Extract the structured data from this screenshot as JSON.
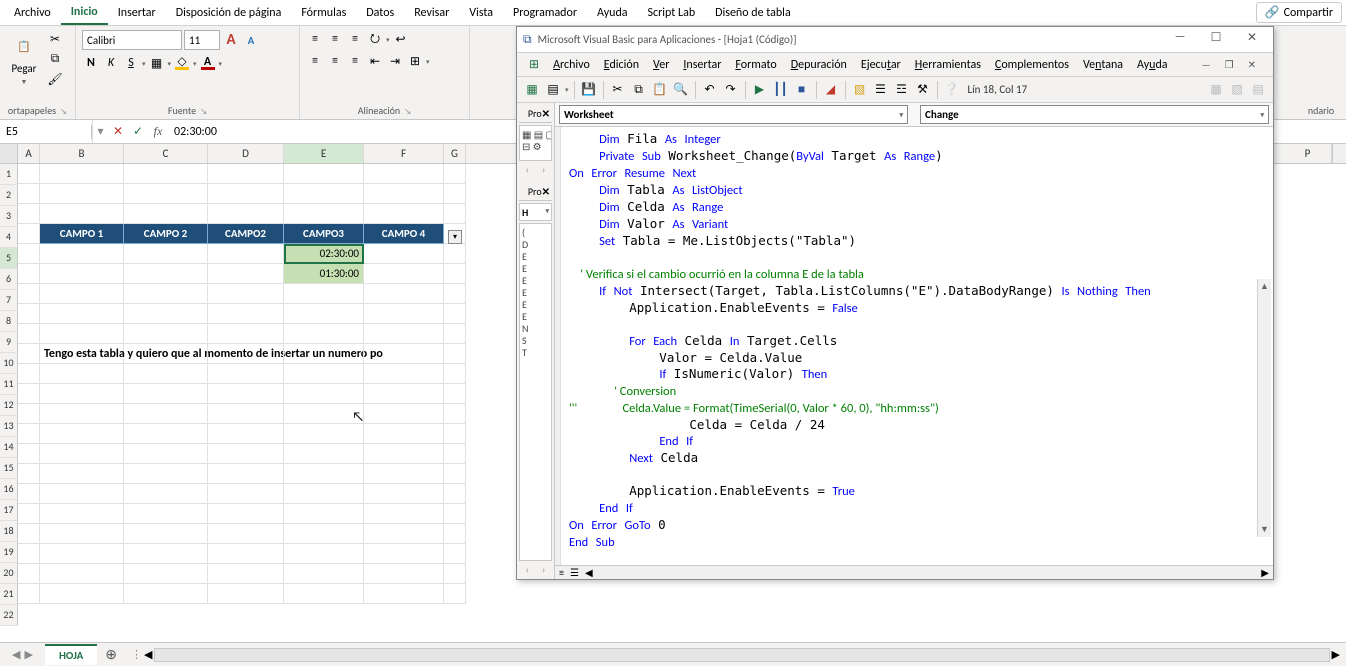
{
  "ribbon": {
    "tabs": [
      "Archivo",
      "Inicio",
      "Insertar",
      "Disposición de página",
      "Fórmulas",
      "Datos",
      "Revisar",
      "Vista",
      "Programador",
      "Ayuda",
      "Script Lab",
      "Diseño de tabla"
    ],
    "active_tab": "Inicio",
    "share": "Compartir",
    "paste_label": "Pegar",
    "group_clipboard": "ortapapeles",
    "group_font": "Fuente",
    "group_align": "Alineación",
    "calendar_rem": "ndario",
    "font_name": "Calibri",
    "font_size": "11"
  },
  "formula_bar": {
    "name": "E5",
    "value": "02:30:00"
  },
  "grid": {
    "cols": [
      "A",
      "B",
      "C",
      "D",
      "E",
      "F",
      "G"
    ],
    "right_col": "P",
    "row_start": 1,
    "active_row": 5,
    "active_col": "E",
    "table_headers": [
      "CAMPO 1",
      "CAMPO 2",
      "CAMPO2",
      "CAMPO3",
      "CAMPO 4"
    ],
    "table_header_row": 4,
    "data": {
      "E5": "02:30:00",
      "E6": "01:30:00"
    },
    "note_row": 10,
    "note": "Tengo esta tabla y quiero que al momento de insertar un numero po"
  },
  "sheet_tab": "HOJA",
  "vba": {
    "title": "Microsoft Visual Basic para Aplicaciones - [Hoja1 (Código)]",
    "menus": [
      "Archivo",
      "Edición",
      "Ver",
      "Insertar",
      "Formato",
      "Depuración",
      "Ejecutar",
      "Herramientas",
      "Complementos",
      "Ventana",
      "Ayuda"
    ],
    "pos": "Lín 18, Col 17",
    "combo_left": "Worksheet",
    "combo_right": "Change",
    "proj_short": "Pro",
    "prop_short": "Pro",
    "prop_combo": "H",
    "prop_lines": [
      "(",
      "D",
      "E",
      "E",
      "E",
      "E",
      "E",
      "E",
      "N",
      "S",
      "T"
    ],
    "code": "    Dim Fila As Integer\n    Private Sub Worksheet_Change(ByVal Target As Range)\nOn Error Resume Next\n    Dim Tabla As ListObject\n    Dim Celda As Range\n    Dim Valor As Variant\n    Set Tabla = Me.ListObjects(\"Tabla\")\n\n    ' Verifica si el cambio ocurrió en la columna E de la tabla\n    If Not Intersect(Target, Tabla.ListColumns(\"E\").DataBodyRange) Is Nothing Then\n        Application.EnableEvents = False\n\n        For Each Celda In Target.Cells\n            Valor = Celda.Value\n            If IsNumeric(Valor) Then\n                ' Conversion\n'''                Celda.Value = Format(TimeSerial(0, Valor * 60, 0), \"hh:mm:ss\")\n                Celda = Celda / 24\n            End If\n        Next Celda\n\n        Application.EnableEvents = True\n    End If\nOn Error GoTo 0\nEnd Sub"
  }
}
